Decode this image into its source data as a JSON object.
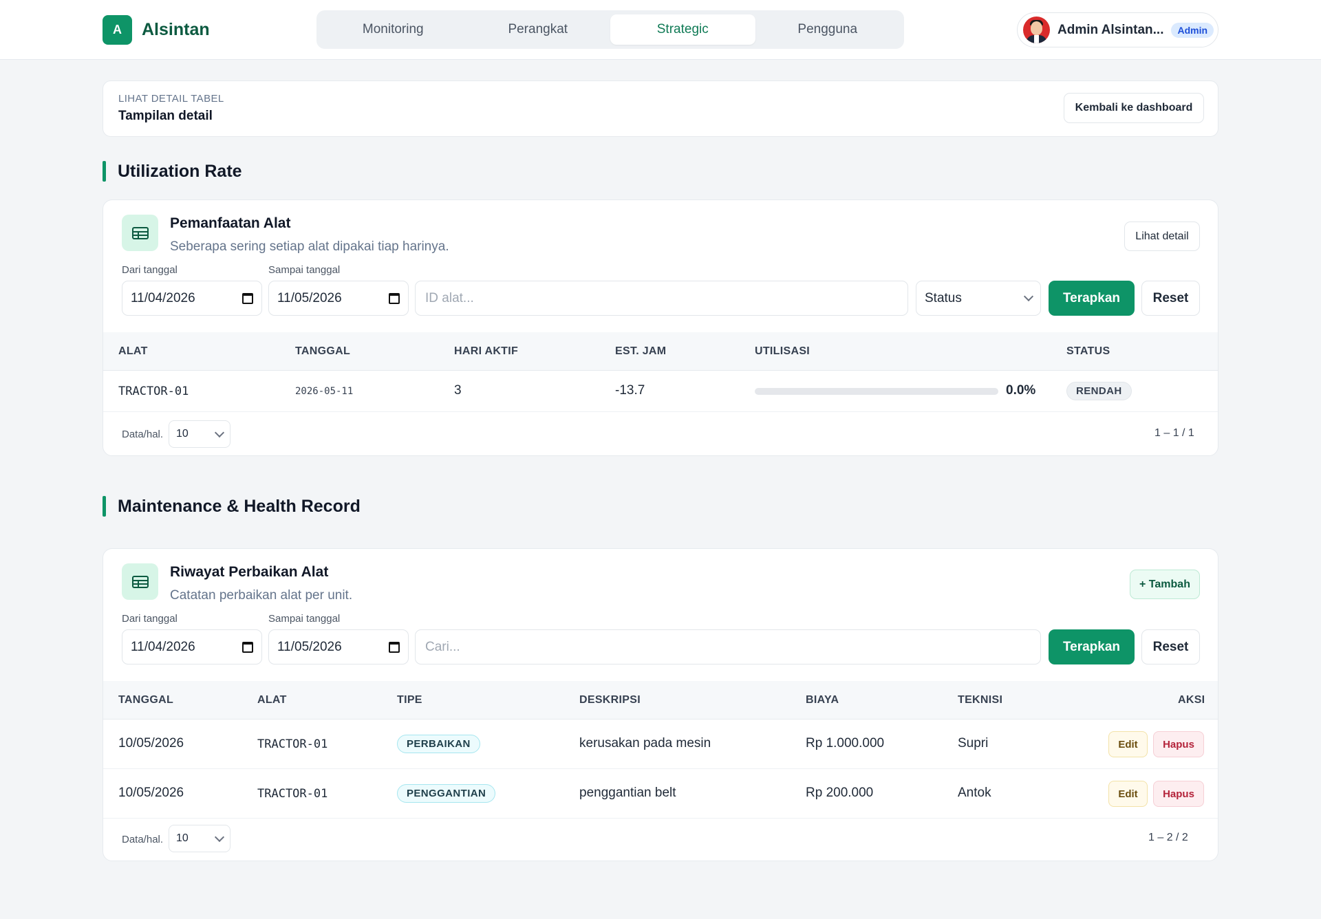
{
  "app": {
    "logo_letter": "A",
    "name": "Alsintan"
  },
  "nav": {
    "tabs": [
      {
        "label": "Monitoring"
      },
      {
        "label": "Perangkat"
      },
      {
        "label": "Strategic",
        "active": true
      },
      {
        "label": "Pengguna"
      }
    ]
  },
  "user": {
    "name": "Admin Alsintan...",
    "role": "Admin"
  },
  "detail": {
    "kicker": "LIHAT DETAIL TABEL",
    "title": "Tampilan detail",
    "back_label": "Kembali ke dashboard"
  },
  "utilization": {
    "section_title": "Utilization Rate",
    "card_title": "Pemanfaatan Alat",
    "card_subtitle": "Seberapa sering setiap alat dipakai tiap harinya.",
    "detail_button": "Lihat detail",
    "filters": {
      "from_label": "Dari tanggal",
      "from_value": "11/04/2026",
      "to_label": "Sampai tanggal",
      "to_value": "11/05/2026",
      "id_placeholder": "ID alat...",
      "status_label": "Status",
      "apply_label": "Terapkan",
      "reset_label": "Reset"
    },
    "columns": [
      "ALAT",
      "TANGGAL",
      "HARI AKTIF",
      "EST. JAM",
      "UTILISASI",
      "STATUS"
    ],
    "rows": [
      {
        "alat": "TRACTOR-01",
        "tanggal": "2026-05-11",
        "hari_aktif": "3",
        "est_jam": "-13.7",
        "utilisasi": "0.0%",
        "utilisasi_fraction": 0.0,
        "status": "RENDAH"
      }
    ],
    "footer": {
      "per_page_label": "Data/hal.",
      "per_page_value": "10",
      "pager": "1 – 1 / 1"
    }
  },
  "maintenance": {
    "section_title": "Maintenance & Health Record",
    "card_title": "Riwayat Perbaikan Alat",
    "card_subtitle": "Catatan perbaikan alat per unit.",
    "add_button": "+ Tambah",
    "filters": {
      "from_label": "Dari tanggal",
      "from_value": "11/04/2026",
      "to_label": "Sampai tanggal",
      "to_value": "11/05/2026",
      "search_placeholder": "Cari...",
      "apply_label": "Terapkan",
      "reset_label": "Reset"
    },
    "columns": [
      "TANGGAL",
      "ALAT",
      "TIPE",
      "DESKRIPSI",
      "BIAYA",
      "TEKNISI",
      "AKSI"
    ],
    "rows": [
      {
        "tanggal": "10/05/2026",
        "alat": "TRACTOR-01",
        "tipe": "PERBAIKAN",
        "deskripsi": "kerusakan pada mesin",
        "biaya": "Rp 1.000.000",
        "teknisi": "Supri",
        "edit": "Edit",
        "hapus": "Hapus"
      },
      {
        "tanggal": "10/05/2026",
        "alat": "TRACTOR-01",
        "tipe": "PENGGANTIAN",
        "deskripsi": "penggantian belt",
        "biaya": "Rp 200.000",
        "teknisi": "Antok",
        "edit": "Edit",
        "hapus": "Hapus"
      }
    ],
    "footer": {
      "per_page_label": "Data/hal.",
      "per_page_value": "10",
      "pager": "1 – 2 / 2"
    }
  },
  "colors": {
    "brand": "#0e9467",
    "brand_dark": "#0c5a40",
    "background": "#f3f5f7"
  },
  "icons": {
    "table": "table-icon",
    "calendar": "calendar-icon",
    "chevron": "chevron-down-icon"
  }
}
